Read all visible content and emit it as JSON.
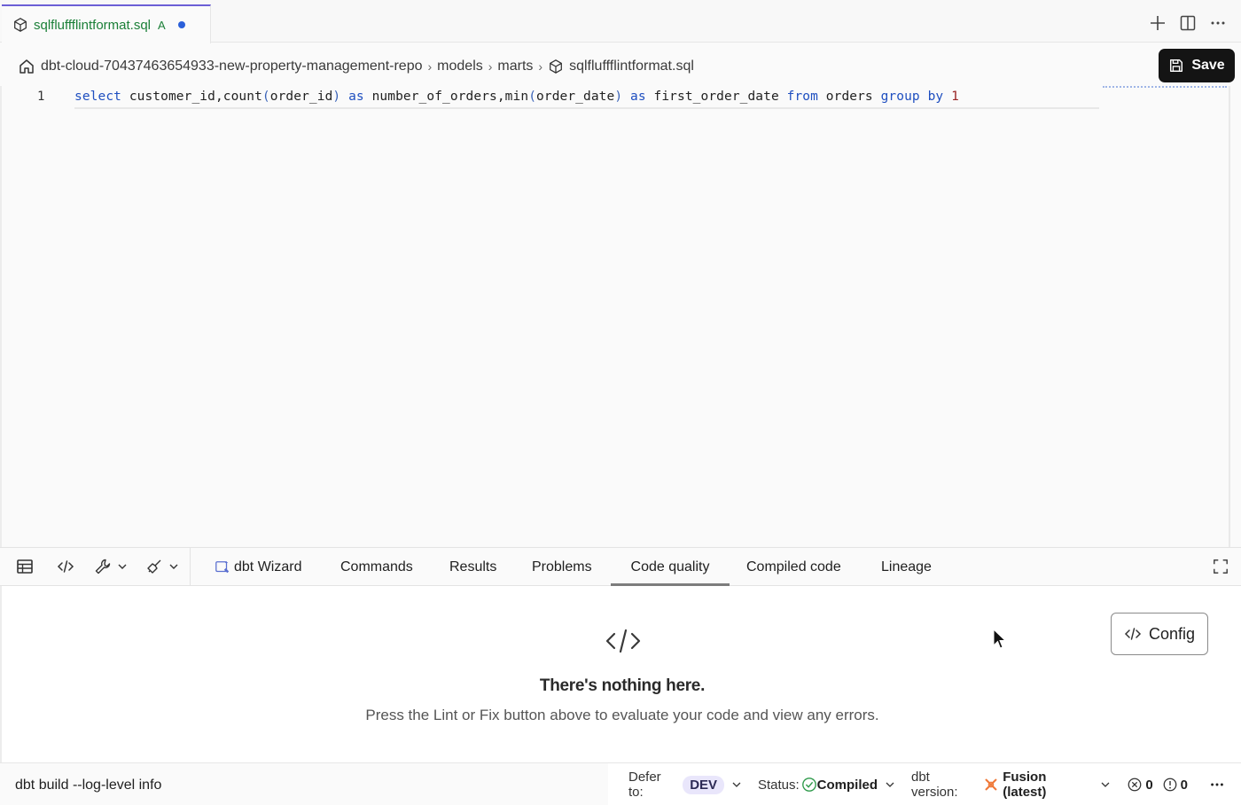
{
  "tab": {
    "filename": "sqlfluffflintformat.sql",
    "status_letter": "A"
  },
  "breadcrumb": {
    "repo": "dbt-cloud-70437463654933-new-property-management-repo",
    "folder1": "models",
    "folder2": "marts",
    "file": "sqlfluffflintformat.sql"
  },
  "toolbar": {
    "save_label": "Save"
  },
  "editor": {
    "line_number": "1",
    "tokens": {
      "t1": "select",
      "t2": " customer_id,count",
      "t3": "(",
      "t4": "order_id",
      "t5": ")",
      "t6": " as",
      "t7": " number_of_orders,min",
      "t8": "(",
      "t9": "order_date",
      "t10": ")",
      "t11": " as",
      "t12": " first_order_date ",
      "t13": "from",
      "t14": " orders ",
      "t15": "group by",
      "t16": " 1"
    }
  },
  "panel": {
    "tabs": {
      "wizard": "dbt Wizard",
      "commands": "Commands",
      "results": "Results",
      "problems": "Problems",
      "code_quality": "Code quality",
      "compiled": "Compiled code",
      "lineage": "Lineage"
    },
    "active_tab": "Code quality",
    "empty_title": "There's nothing here.",
    "empty_message": "Press the Lint or Fix button above to evaluate your code and view any errors.",
    "config_label": "Config"
  },
  "statusbar": {
    "command": "dbt build --log-level info",
    "defer_label": "Defer to:",
    "defer_value": "DEV",
    "status_label": "Status:",
    "status_value": "Compiled",
    "version_label": "dbt version:",
    "version_value": "Fusion (latest)",
    "errors_count": "0",
    "warnings_count": "0"
  },
  "colors": {
    "accent": "#6b5fd6",
    "save_bg": "#141414",
    "keyword": "#1f4fc0",
    "added_file": "#1a7f37",
    "unsaved_dot": "#2b5fd9",
    "compiled_ok": "#2e9a4a"
  },
  "icons": [
    "cube-icon",
    "plus-icon",
    "split-editor-icon",
    "more-icon",
    "home-icon",
    "save-icon",
    "table-icon",
    "code-icon",
    "wrench-icon",
    "broom-icon",
    "wizard-icon",
    "expand-icon",
    "error-icon",
    "warning-icon",
    "check-circle-icon"
  ]
}
